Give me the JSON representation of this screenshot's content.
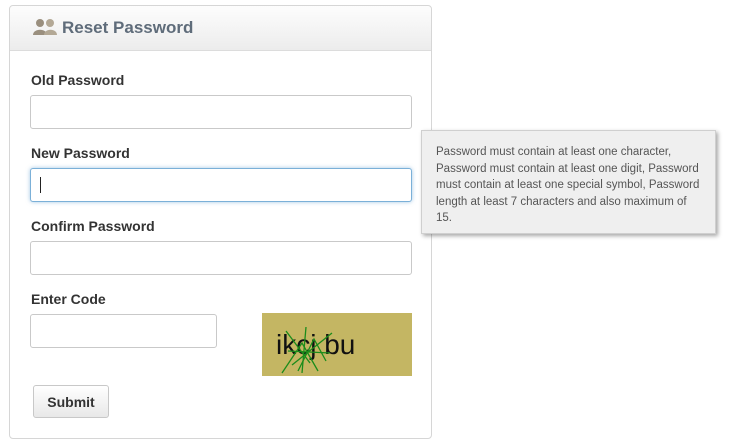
{
  "header": {
    "title": "Reset Password",
    "icon": "users-icon"
  },
  "form": {
    "old_password": {
      "label": "Old Password",
      "value": ""
    },
    "new_password": {
      "label": "New Password",
      "value": ""
    },
    "confirm_password": {
      "label": "Confirm Password",
      "value": ""
    },
    "enter_code": {
      "label": "Enter Code",
      "value": ""
    },
    "captcha_text": "ikcj bu",
    "submit_label": "Submit"
  },
  "tooltip": {
    "text": "Password must contain at least one character, Password must contain at least one digit, Password must contain at least one special symbol, Password length at least 7 characters and also maximum of 15."
  },
  "colors": {
    "title": "#5f6c7a",
    "focus_border": "#7bb0d8",
    "captcha_background": "#c9bb6a",
    "captcha_noise": "#1a8c1a"
  }
}
